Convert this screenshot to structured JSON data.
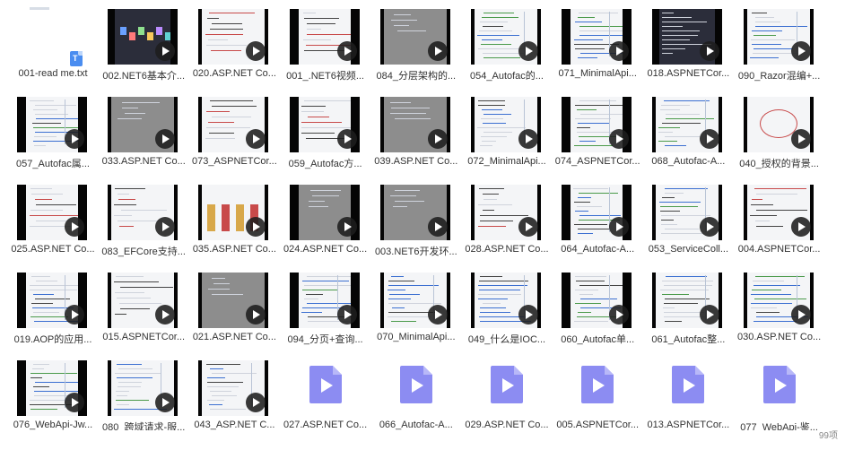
{
  "status": {
    "count": "99项"
  },
  "files": [
    {
      "name": "001-read me.txt",
      "kind": "txt"
    },
    {
      "name": "002.NET6基本介...",
      "kind": "video",
      "style": "dark"
    },
    {
      "name": "020.ASP.NET Co...",
      "kind": "video",
      "style": "doc"
    },
    {
      "name": "001_.NET6视频...",
      "kind": "video",
      "style": "doc"
    },
    {
      "name": "084_分层架构的...",
      "kind": "video",
      "style": "gray"
    },
    {
      "name": "054_Autofac的...",
      "kind": "video",
      "style": "code"
    },
    {
      "name": "071_MinimalApi...",
      "kind": "video",
      "style": "code"
    },
    {
      "name": "018.ASPNETCor...",
      "kind": "video",
      "style": "console"
    },
    {
      "name": "090_Razor混编+...",
      "kind": "video",
      "style": "code"
    },
    {
      "name": "057_Autofac属...",
      "kind": "video",
      "style": "code"
    },
    {
      "name": "033.ASP.NET Co...",
      "kind": "video",
      "style": "gray"
    },
    {
      "name": "073_ASPNETCor...",
      "kind": "video",
      "style": "doc"
    },
    {
      "name": "059_Autofac方...",
      "kind": "video",
      "style": "doc"
    },
    {
      "name": "039.ASP.NET Co...",
      "kind": "video",
      "style": "gray"
    },
    {
      "name": "072_MinimalApi...",
      "kind": "video",
      "style": "code"
    },
    {
      "name": "074_ASPNETCor...",
      "kind": "video",
      "style": "code"
    },
    {
      "name": "068_Autofac-A...",
      "kind": "video",
      "style": "code"
    },
    {
      "name": "040_授权的背景...",
      "kind": "video",
      "style": "diagram"
    },
    {
      "name": "025.ASP.NET Co...",
      "kind": "video",
      "style": "doc"
    },
    {
      "name": "083_EFCore支持...",
      "kind": "video",
      "style": "doc"
    },
    {
      "name": "035.ASP.NET Co...",
      "kind": "video",
      "style": "bars"
    },
    {
      "name": "024.ASP.NET Co...",
      "kind": "video",
      "style": "gray"
    },
    {
      "name": "003.NET6开发环...",
      "kind": "video",
      "style": "gray"
    },
    {
      "name": "028.ASP.NET Co...",
      "kind": "video",
      "style": "doc"
    },
    {
      "name": "064_Autofac-A...",
      "kind": "video",
      "style": "code"
    },
    {
      "name": "053_ServiceColl...",
      "kind": "video",
      "style": "code"
    },
    {
      "name": "004.ASPNETCor...",
      "kind": "video",
      "style": "doc"
    },
    {
      "name": "019.AOP的应用...",
      "kind": "video",
      "style": "code"
    },
    {
      "name": "015.ASPNETCor...",
      "kind": "video",
      "style": "doc"
    },
    {
      "name": "021.ASP.NET Co...",
      "kind": "video",
      "style": "gray"
    },
    {
      "name": "094_分页+查询...",
      "kind": "video",
      "style": "code"
    },
    {
      "name": "070_MinimalApi...",
      "kind": "video",
      "style": "code"
    },
    {
      "name": "049_什么是IOC...",
      "kind": "video",
      "style": "code"
    },
    {
      "name": "060_Autofac单...",
      "kind": "video",
      "style": "code"
    },
    {
      "name": "061_Autofac整...",
      "kind": "video",
      "style": "code"
    },
    {
      "name": "030.ASP.NET Co...",
      "kind": "video",
      "style": "code"
    },
    {
      "name": "076_WebApi-Jw...",
      "kind": "video",
      "style": "code"
    },
    {
      "name": "080_跨域请求-服...",
      "kind": "video",
      "style": "code"
    },
    {
      "name": "043_ASP.NET C...",
      "kind": "video",
      "style": "code"
    },
    {
      "name": "027.ASP.NET Co...",
      "kind": "vfile"
    },
    {
      "name": "066_Autofac-A...",
      "kind": "vfile"
    },
    {
      "name": "029.ASP.NET Co...",
      "kind": "vfile"
    },
    {
      "name": "005.ASPNETCor...",
      "kind": "vfile"
    },
    {
      "name": "013.ASPNETCor...",
      "kind": "vfile"
    },
    {
      "name": "077_WebApi-鉴...",
      "kind": "vfile"
    }
  ]
}
